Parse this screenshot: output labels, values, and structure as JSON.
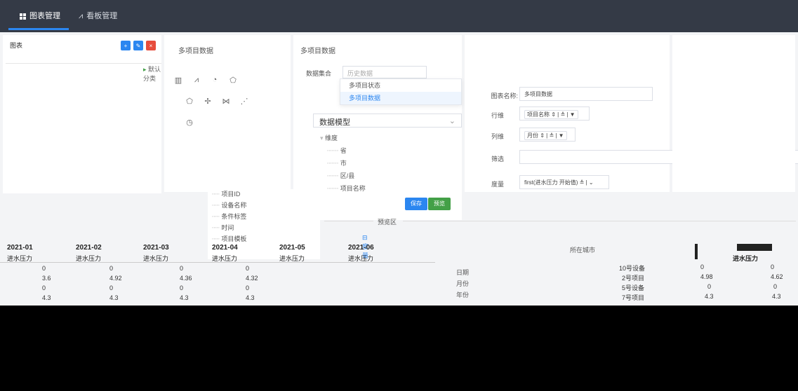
{
  "topbar": {
    "tabs": [
      {
        "label": "图表管理",
        "active": true
      },
      {
        "label": "看板管理",
        "active": false
      }
    ],
    "accent": "#2b86f0",
    "bg": "#343a46"
  },
  "left_panel": {
    "header": "图表",
    "tree": {
      "default_folder": "默认分类"
    }
  },
  "chart_list": {
    "title": "多项目数据",
    "icons": [
      "bar-chart-icon",
      "line-chart-icon",
      "pie-chart-icon",
      "radar-chart-icon",
      "scatter-chart-icon",
      "funnel-chart-icon",
      "gauge-icon"
    ]
  },
  "form": {
    "title": "多项目数据",
    "dataset_label": "数据集合",
    "dataset_placeholder": "历史数据",
    "dropdown_options": [
      "多项目状态",
      "多项目数据"
    ],
    "selected_option": "多项目数据",
    "model_label": "数据模型",
    "model_tree": {
      "root": "维度",
      "items": [
        "省",
        "市",
        "区/县",
        "项目名称"
      ]
    },
    "fields": [
      "项目ID",
      "设备名称",
      "条件标签",
      "时间",
      "项目模板"
    ],
    "fields_extra": "度量"
  },
  "right_form": {
    "chart_name_label": "图表名称:",
    "chart_name_value": "多项目数据",
    "row_label": "行维",
    "row_value": "项目名称",
    "col_label": "列维",
    "col_value": "月份",
    "filter_label": "筛选",
    "measure_label": "度量",
    "measure_value": "first(进水压力 开始值)"
  },
  "buttons": {
    "save": "保存",
    "preview": "预览"
  },
  "preview": {
    "label": "预览区",
    "columns": [
      "2021-01",
      "2021-02",
      "2021-03",
      "2021-04",
      "2021-05",
      "2021-06"
    ],
    "sub_label": "进水压力",
    "rows": [
      [
        "0",
        "0",
        "0",
        "0",
        "",
        ""
      ],
      [
        "3.6",
        "4.92",
        "4.36",
        "4.32",
        "",
        ""
      ],
      [
        "0",
        "0",
        "0",
        "0",
        "",
        ""
      ],
      [
        "4.3",
        "4.3",
        "4.3",
        "4.3",
        "",
        ""
      ]
    ]
  },
  "right_table": {
    "dims": [
      "日期",
      "月份",
      "年份"
    ],
    "header_extra": "所在城市",
    "col_value": "进水压力",
    "rows": [
      {
        "name": "10号设备",
        "a": "0",
        "b": "0"
      },
      {
        "name": "2号项目",
        "a": "4.98",
        "b": "4.62"
      },
      {
        "name": "5号设备",
        "a": "0",
        "b": "0"
      },
      {
        "name": "7号项目",
        "a": "4.3",
        "b": "4.3"
      }
    ]
  }
}
